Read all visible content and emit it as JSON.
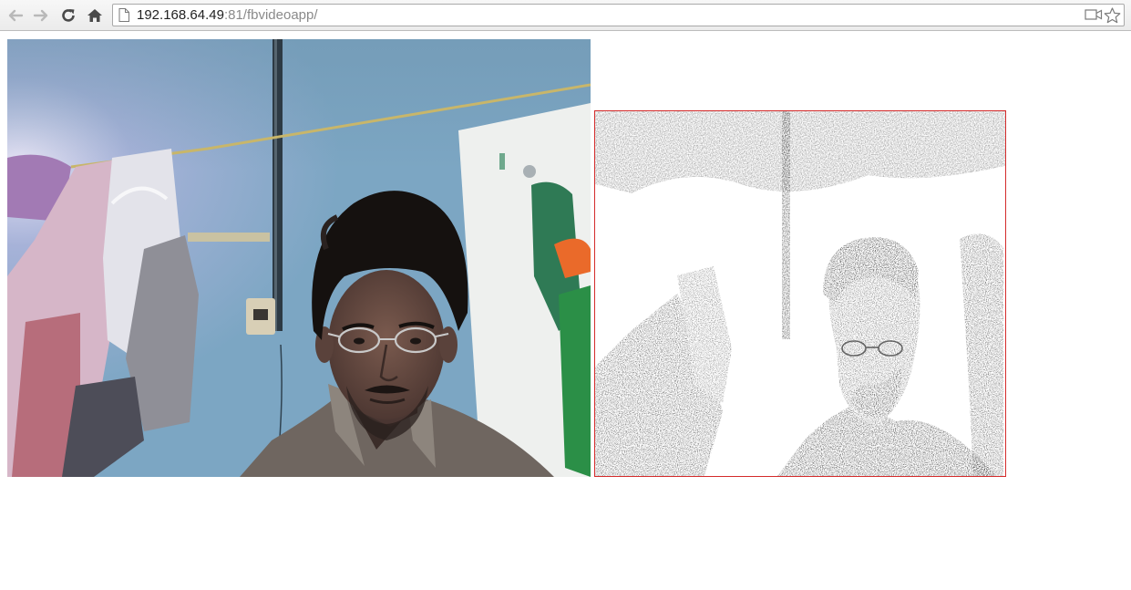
{
  "browser": {
    "url_host": "192.168.64.49",
    "url_rest": ":81/fbvideoapp/",
    "buttons": {
      "back": "back-arrow-icon",
      "forward": "forward-arrow-icon",
      "reload": "reload-icon",
      "home": "home-icon"
    },
    "omnibox_icons": [
      "page-icon",
      "video-camera-icon",
      "bookmark-star-icon"
    ]
  },
  "page": {
    "video": {
      "type": "live webcam feed"
    },
    "canvas": {
      "type": "processed grayscale frame",
      "border_color": "#d42b2b"
    }
  },
  "colors": {
    "toolbar": "#ebebeb",
    "wall": "#7fa9c6",
    "canvas_border": "#d42b2b"
  }
}
